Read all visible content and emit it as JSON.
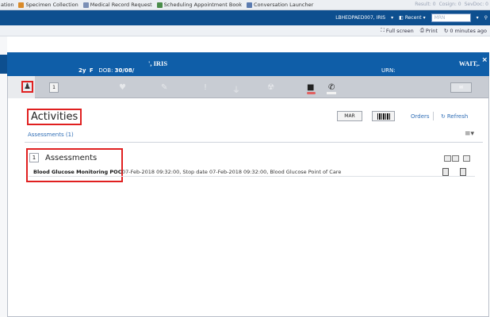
{
  "toolbar": {
    "items": [
      {
        "icon": "specimen-icon",
        "label": "ation",
        "color": "#d98b2b"
      },
      {
        "icon": "specimen-icon",
        "label": "Specimen Collection",
        "color": "#d98b2b"
      },
      {
        "icon": "record-icon",
        "label": "Medical Record Request",
        "color": "#7b8fb5"
      },
      {
        "icon": "calendar-icon",
        "label": "Scheduling Appointment Book",
        "color": "#4a8c4a"
      },
      {
        "icon": "chat-icon",
        "label": "Conversation Launcher",
        "color": "#5a7bb0"
      }
    ],
    "right": [
      "Result: 0",
      "Cosign: 0",
      "SevDoc: 0"
    ]
  },
  "app_bar": {
    "user": "LBHEDPAED007, IRIS",
    "recent_label": "Recent",
    "mrn_placeholder": "MRN"
  },
  "sub_bar": {
    "full_screen": "Full screen",
    "print": "Print",
    "time_ago": "0 minutes ago"
  },
  "patient": {
    "name": "', IRIS",
    "age": "2y",
    "sex": "F",
    "dob_label": "DOB:",
    "dob": "30/08/",
    "urn_label": "URN:",
    "status": "WAIT,."
  },
  "icon_bar": {
    "count": "1"
  },
  "page": {
    "title": "Activities",
    "mar_label": "MAR",
    "orders_label": "Orders",
    "refresh_label": "Refresh",
    "filter_link": "Assessments (1)"
  },
  "group": {
    "count": "1",
    "title": "Assessments",
    "tasks": [
      {
        "name": "Blood Glucose Monitoring POC",
        "detail": "07-Feb-2018 09:32:00, Stop date 07-Feb-2018 09:32:00, Blood Glucose Point of Care"
      }
    ]
  }
}
